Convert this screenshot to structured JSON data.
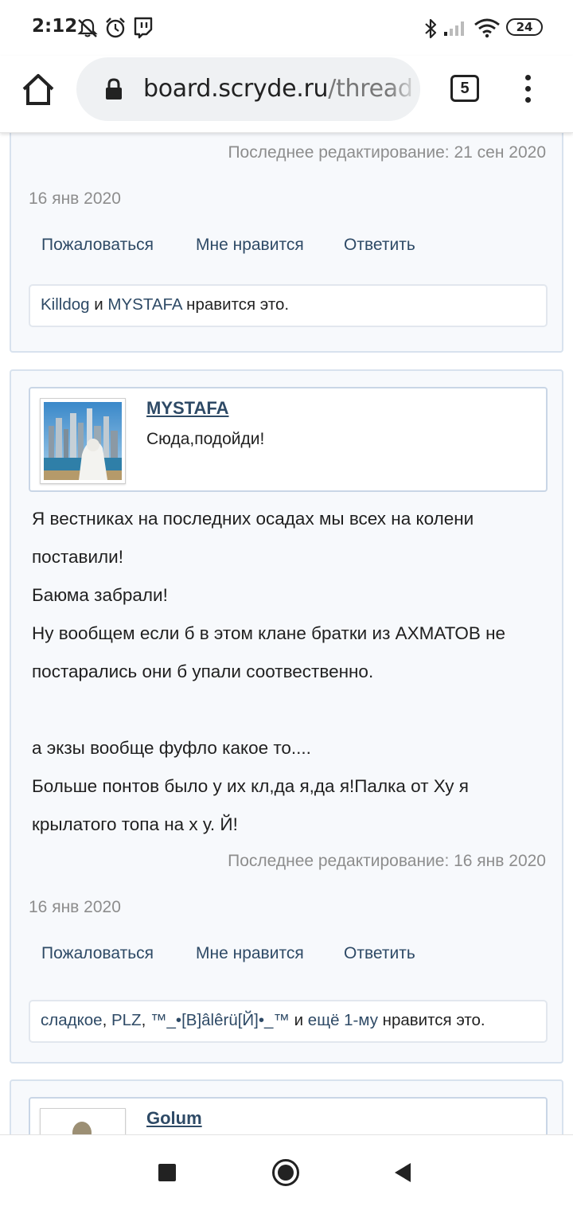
{
  "status_bar": {
    "time": "2:12",
    "battery": "24",
    "icons": [
      "mute-icon",
      "alarm-icon",
      "twitch-icon",
      "bluetooth-icon",
      "signal-icon",
      "wifi-icon",
      "battery-icon"
    ]
  },
  "browser": {
    "url_host": "board.scryde.ru",
    "url_path": "/thread",
    "tab_count": "5"
  },
  "posts": [
    {
      "edited": "Последнее редактирование: 21 сен 2020",
      "date": "16 янв 2020",
      "actions": {
        "report": "Пожаловаться",
        "like": "Мне нравится",
        "reply": "Ответить"
      },
      "likes": {
        "user1": "Killdog",
        "and": "и",
        "user2": "MYSTAFA",
        "suffix": "нравится это."
      }
    },
    {
      "author": {
        "name": "MYSTAFA",
        "title": "Сюда,подойди!"
      },
      "body": [
        "Я вестниках на последних осадах мы всех на колени",
        "поставили!",
        "Баюма забрали!",
        "Ну вообщем если б в этом клане братки из АХМАТОВ не",
        "постарались они б упали соотвественно.",
        "",
        "а экзы вообще фуфло какое то....",
        "Больше понтов было у их кл,да я,да я!Палка от Ху я",
        "крылатого топа на х у. Й!"
      ],
      "edited": "Последнее редактирование: 16 янв 2020",
      "date": "16 янв 2020",
      "actions": {
        "report": "Пожаловаться",
        "like": "Мне нравится",
        "reply": "Ответить"
      },
      "likes": {
        "user1": "сладкое",
        "sep1": ",",
        "user2": "PLZ",
        "sep2": ",",
        "user3": "™_•[B]âlêrü[Й]•_™",
        "and": "и",
        "more": "ещё 1-му",
        "suffix": "нравится это."
      }
    },
    {
      "author": {
        "name": "Golum"
      }
    }
  ],
  "nav": {
    "icons": [
      "recents-icon",
      "home-icon",
      "back-icon"
    ]
  }
}
